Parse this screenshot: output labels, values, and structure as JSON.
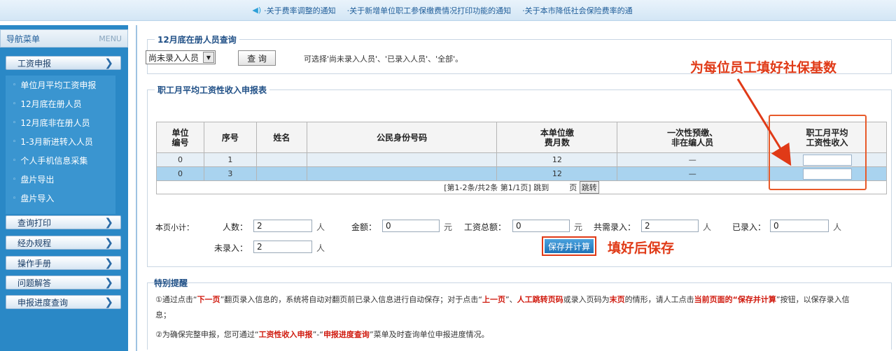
{
  "topbar": {
    "notices": [
      "·关于费率调整的通知",
      "·关于新增单位职工参保缴费情况打印功能的通知",
      "·关于本市降低社会保险费率的通"
    ]
  },
  "sidebar": {
    "title": "导航菜单",
    "menu_label": "MENU",
    "items": [
      {
        "label": "工资申报"
      },
      {
        "label": "查询打印"
      },
      {
        "label": "经办规程"
      },
      {
        "label": "操作手册"
      },
      {
        "label": "问题解答"
      },
      {
        "label": "申报进度查询"
      }
    ],
    "subitems": [
      {
        "label": "单位月平均工资申报"
      },
      {
        "label": "12月底在册人员"
      },
      {
        "label": "12月底非在册人员"
      },
      {
        "label": "1-3月新进转入人员"
      },
      {
        "label": "个人手机信息采集"
      },
      {
        "label": "盘片导出"
      },
      {
        "label": "盘片导入"
      }
    ]
  },
  "query": {
    "legend": "12月底在册人员查询",
    "select_value": "尚未录入人员",
    "query_button": "查 询",
    "hint": "可选择'尚未录入人员'、'已录入人员'、'全部'。"
  },
  "form": {
    "legend": "职工月平均工资性收入申报表",
    "headers": {
      "unit_no_1": "单位",
      "unit_no_2": "编号",
      "seq": "序号",
      "name": "姓名",
      "id": "公民身份号码",
      "months_1": "本单位缴",
      "months_2": "费月数",
      "onetime_1": "一次性预缴、",
      "onetime_2": "非在编人员",
      "income_1": "职工月平均",
      "income_2": "工资性收入"
    },
    "rows": [
      {
        "unit": "0",
        "seq": "1",
        "name": "",
        "id": "",
        "months": "12",
        "onetime": "—"
      },
      {
        "unit": "0",
        "seq": "3",
        "name": "",
        "id": "",
        "months": "12",
        "onetime": "—"
      }
    ],
    "pager": "[第1-2条/共2条 第1/1页] 跳到",
    "pager_unit": "页",
    "jump_button": "跳转"
  },
  "annotations": {
    "fill_base": "为每位员工填好社保基数",
    "fill_save": "填好后保存"
  },
  "summary": {
    "label": "本页小计：",
    "headcount_label": "人数：",
    "headcount": "2",
    "amount_label": "金额：",
    "amount": "0",
    "total_wage_label": "工资总额：",
    "total_wage": "0",
    "need_label": "共需录入：",
    "need": "2",
    "done_label": "已录入：",
    "done": "0",
    "pending_label": "未录入：",
    "pending": "2",
    "unit_person": "人",
    "unit_yuan": "元",
    "save_button": "保存并计算"
  },
  "notes": {
    "title": "特别提醒",
    "n1_a": "①通过点击“",
    "n1_b": "下一页",
    "n1_c": "”翻页录入信息的，系统将自动对翻页前已录入信息进行自动保存；对于点击“",
    "n1_d": "上一页",
    "n1_e": "”、",
    "n1_f": "人工跳转页码",
    "n1_g": "或录入页码为",
    "n1_h": "末页",
    "n1_i": "的情形，请人工点击",
    "n1_j": "当前页面的",
    "n1_k": "“保存并计算",
    "n1_l": "”按钮，以保存录入信",
    "n1_cont": "息；",
    "n2_a": "②为确保完整申报，您可通过“",
    "n2_b": "工资性收入申报",
    "n2_c": "”-“",
    "n2_d": "申报进度查询",
    "n2_e": "”菜单及时查询单位申报进度情况。"
  }
}
